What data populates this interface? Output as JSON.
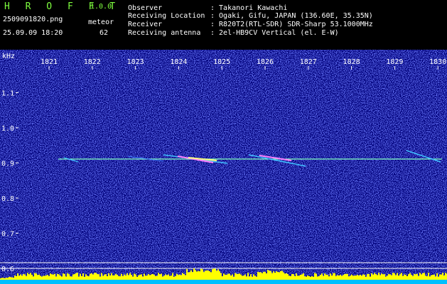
{
  "header": {
    "logo": "H R O F F T",
    "version": "1.0.0",
    "filename": "2509091820.png",
    "datetime": "25.09.09 18:20",
    "meteor_label": "meteor",
    "meteor_count": "62",
    "info": [
      {
        "label": "Observer",
        "value": ": Takanori Kawachi"
      },
      {
        "label": "Receiving Location",
        "value": ": Ogaki, Gifu, JAPAN (136.60E, 35.35N)"
      },
      {
        "label": "Receiver",
        "value": ": R820T2(RTL-SDR) SDR-Sharp 53.1000MHz"
      },
      {
        "label": "Receiving antenna",
        "value": ": 2el-HB9CV Vertical (el. E-W)"
      }
    ]
  },
  "axis": {
    "unit": "kHz",
    "x_ticks": [
      "1821",
      "1822",
      "1823",
      "1824",
      "1825",
      "1826",
      "1827",
      "1828",
      "1829",
      "1830"
    ],
    "y_ticks": [
      "1.1",
      "1.0",
      "0.9",
      "0.8",
      "0.7",
      "0.6"
    ],
    "y_values": [
      1.1,
      1.0,
      0.9,
      0.8,
      0.7,
      0.6
    ]
  },
  "colors": {
    "background": "#00007a",
    "trace": "#7fffbf",
    "bars": "#ffff00",
    "bottom": "#00c0ff",
    "header_green": "#7fff3f"
  }
}
